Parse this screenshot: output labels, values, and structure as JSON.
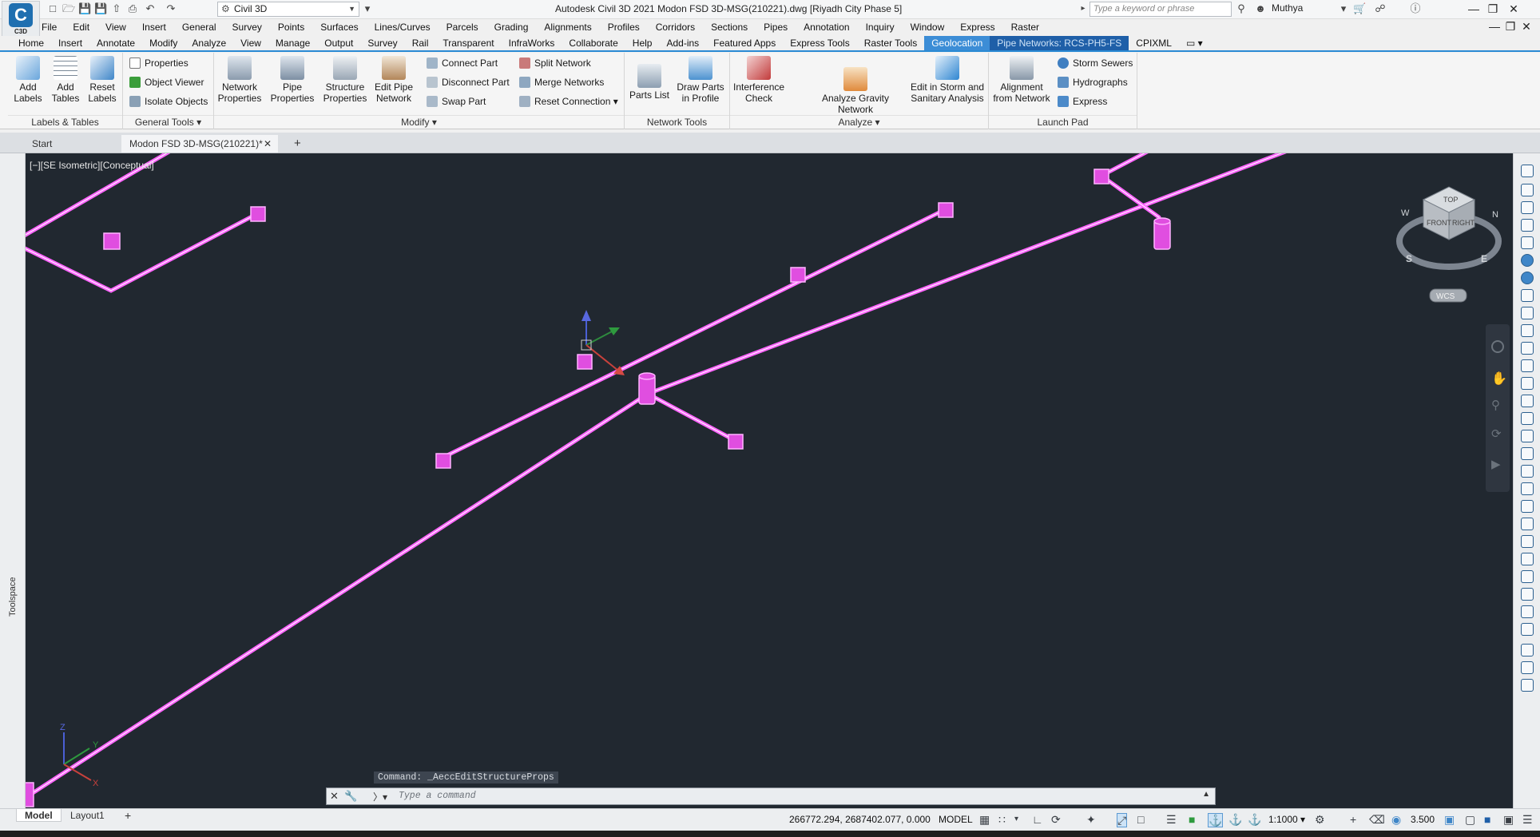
{
  "app": {
    "badge": "C3D",
    "workspace": "Civil 3D",
    "window_title": "Autodesk Civil 3D 2021   Modon FSD 3D-MSG(210221).dwg [Riyadh City Phase 5]",
    "search_placeholder": "Type a keyword or phrase",
    "user": "Muthya"
  },
  "menu": [
    "File",
    "Edit",
    "View",
    "Insert",
    "General",
    "Survey",
    "Points",
    "Surfaces",
    "Lines/Curves",
    "Parcels",
    "Grading",
    "Alignments",
    "Profiles",
    "Corridors",
    "Sections",
    "Pipes",
    "Annotation",
    "Inquiry",
    "Window",
    "Express",
    "Raster"
  ],
  "ribbon_tabs": [
    "Home",
    "Insert",
    "Annotate",
    "Modify",
    "Analyze",
    "View",
    "Manage",
    "Output",
    "Survey",
    "Rail",
    "Transparent",
    "InfraWorks",
    "Collaborate",
    "Help",
    "Add-ins",
    "Featured Apps",
    "Express Tools",
    "Raster Tools",
    "Geolocation",
    "Pipe Networks: RCS-PH5-FS",
    "CPIXML"
  ],
  "ribbon": {
    "labels_tables": {
      "label": "Labels & Tables",
      "add_labels": "Add Labels",
      "add_tables": "Add Tables",
      "reset_labels": "Reset Labels"
    },
    "general_tools": {
      "label": "General Tools",
      "properties": "Properties",
      "object_viewer": "Object Viewer",
      "isolate_objects": "Isolate Objects"
    },
    "modify": {
      "label": "Modify",
      "network_properties": "Network Properties",
      "pipe_properties": "Pipe Properties",
      "structure_properties": "Structure Properties",
      "edit_pipe_network": "Edit Pipe Network",
      "connect_part": "Connect Part",
      "disconnect_part": "Disconnect Part",
      "swap_part": "Swap Part",
      "split_network": "Split Network",
      "merge_networks": "Merge Networks",
      "reset_connection": "Reset Connection"
    },
    "network_tools": {
      "label": "Network Tools",
      "parts_list": "Parts List",
      "draw_parts_in_profile": "Draw Parts in Profile"
    },
    "analyze": {
      "label": "Analyze",
      "interference_check": "Interference Check",
      "analyze_gravity_network": "Analyze Gravity Network",
      "edit_storm_sanitary": "Edit in Storm and Sanitary Analysis"
    },
    "launch_pad": {
      "label": "Launch Pad",
      "alignment_from_network": "Alignment from Network",
      "storm_sewers": "Storm Sewers",
      "hydrographs": "Hydrographs",
      "express": "Express"
    }
  },
  "doc_tabs": {
    "start": "Start",
    "active": "Modon FSD 3D-MSG(210221)*"
  },
  "viewport": {
    "label": "[−][SE Isometric][Conceptual]",
    "viewcube": {
      "top": "TOP",
      "front": "FRONT",
      "right": "RIGHT",
      "north": "N",
      "south": "S",
      "east": "E",
      "west": "W",
      "wcs": "WCS"
    },
    "ucs": {
      "x": "X",
      "y": "Y",
      "z": "Z"
    }
  },
  "toolspace_label": "Toolspace",
  "command": {
    "history": "Command:  _AeccEditStructureProps",
    "placeholder": "Type a command"
  },
  "status": {
    "model_tab": "Model",
    "layout_tab": "Layout1",
    "coords": "266772.294, 2687402.077, 0.000",
    "model": "MODEL",
    "scale": "1:1000",
    "annotation_scale": "3.500"
  },
  "colors": {
    "pipe": "#ff66ff",
    "viewport_bg": "#212830",
    "accent": "#2a8ad4"
  }
}
